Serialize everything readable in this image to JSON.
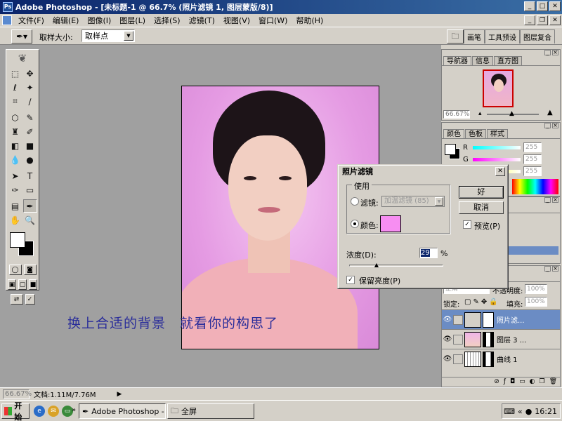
{
  "window": {
    "app_icon": "Ps",
    "title": "Adobe Photoshop - [未标题-1 @ 66.7% (照片滤镜 1, 图层蒙版/8)]"
  },
  "menu": {
    "items": [
      "文件(F)",
      "编辑(E)",
      "图像(I)",
      "图层(L)",
      "选择(S)",
      "滤镜(T)",
      "视图(V)",
      "窗口(W)",
      "帮助(H)"
    ]
  },
  "options": {
    "sample_size_label": "取样大小:",
    "sample_size_value": "取样点"
  },
  "palette_well": {
    "tabs": [
      "画笔",
      "工具预设",
      "图层复合"
    ]
  },
  "caption": "换上合适的背景　就看你的构思了",
  "navigator": {
    "tabs": [
      "导航器",
      "信息",
      "直方图"
    ],
    "zoom": "66.67%"
  },
  "color_palette": {
    "tabs": [
      "颜色",
      "色板",
      "样式"
    ],
    "channels": [
      {
        "label": "R",
        "value": "255"
      },
      {
        "label": "G",
        "value": "255"
      },
      {
        "label": "B",
        "value": "255"
      }
    ]
  },
  "layers": {
    "blend_mode": "正常",
    "opacity_label": "不透明度:",
    "opacity_value": "100%",
    "lock_label": "锁定:",
    "fill_label": "填充:",
    "fill_value": "100%",
    "rows": [
      {
        "name": "照片滤..."
      },
      {
        "name": "图层 3 ..."
      },
      {
        "name": "曲线 1"
      }
    ]
  },
  "status": {
    "zoom": "66.67%",
    "doc": "文档:1.11M/7.76M"
  },
  "dialog": {
    "title": "照片滤镜",
    "use_legend": "使用",
    "filter_label": "滤镜:",
    "filter_value": "加温滤镜 (85)",
    "color_label": "颜色:",
    "selected_color": "#f78ef2",
    "ok_label": "好",
    "cancel_label": "取消",
    "preview_label": "预览(P)",
    "preview_checked": true,
    "density_label": "浓度(D):",
    "density_value": "29",
    "density_unit": "%",
    "density_fraction": 0.29,
    "preserve_label": "保留亮度(P)",
    "preserve_checked": true
  },
  "taskbar": {
    "start_label": "开始",
    "tasks": [
      "Adobe Photoshop - [未...",
      "全屏"
    ],
    "clock": "16:21"
  }
}
